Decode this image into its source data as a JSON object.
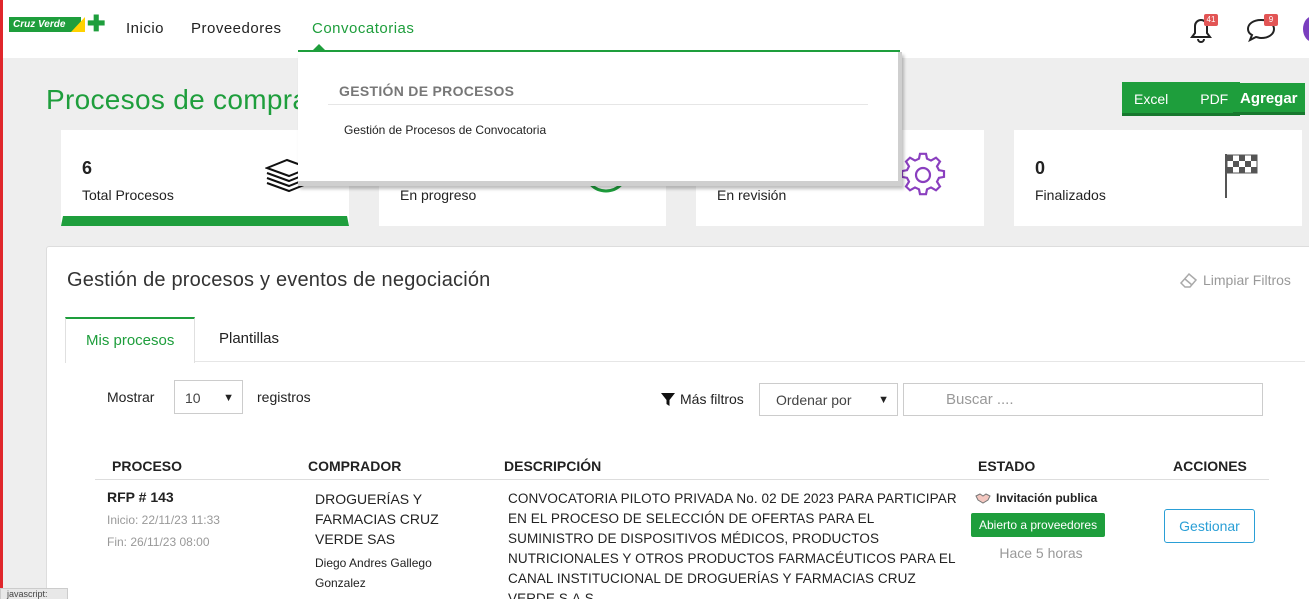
{
  "brand": {
    "logo_text": "Cruz Verde"
  },
  "nav": {
    "items": [
      {
        "label": "Inicio"
      },
      {
        "label": "Proveedores"
      },
      {
        "label": "Convocatorias"
      }
    ],
    "notifications_count": "41",
    "messages_count": "9"
  },
  "dropdown": {
    "heading": "GESTIÓN DE PROCESOS",
    "item": "Gestión de Procesos de Convocatoria"
  },
  "page": {
    "title": "Procesos de compra",
    "excel_label": "Excel",
    "pdf_label": "PDF",
    "add_label": "Agregar"
  },
  "cards": [
    {
      "value": "6",
      "label": "Total Procesos",
      "icon": "stack-icon"
    },
    {
      "value": "",
      "label": "En progreso",
      "icon": "progress-circle-icon"
    },
    {
      "value": "",
      "label": "En revisión",
      "icon": "gear-icon"
    },
    {
      "value": "0",
      "label": "Finalizados",
      "icon": "checkered-flag-icon"
    }
  ],
  "panel": {
    "title": "Gestión de procesos y eventos de negociación",
    "clear_filters": "Limpiar Filtros",
    "tabs": [
      {
        "label": "Mis procesos"
      },
      {
        "label": "Plantillas"
      }
    ],
    "show_label": "Mostrar",
    "page_size": "10",
    "records_label": "registros",
    "more_filters": "Más filtros",
    "sort_placeholder": "Ordenar por",
    "search_placeholder": "Buscar ...."
  },
  "table": {
    "headers": [
      "PROCESO",
      "COMPRADOR",
      "DESCRIPCIÓN",
      "ESTADO",
      "ACCIONES"
    ],
    "rows": [
      {
        "id": "RFP # 143",
        "start": "Inicio: 22/11/23 11:33",
        "end": "Fin: 26/11/23 08:00",
        "buyer": "DROGUERÍAS Y FARMACIAS CRUZ VERDE SAS",
        "contact": "Diego Andres Gallego Gonzalez",
        "description": "CONVOCATORIA PILOTO PRIVADA No. 02 DE 2023 PARA PARTICIPAR EN EL PROCESO DE SELECCIÓN DE OFERTAS PARA EL SUMINISTRO DE DISPOSITIVOS MÉDICOS, PRODUCTOS NUTRICIONALES Y OTROS PRODUCTOS FARMACÉUTICOS PARA EL CANAL INSTITUCIONAL DE DROGUERÍAS Y FARMACIAS CRUZ VERDE S.A.S.",
        "invitation": "Invitación publica",
        "status": "Abierto a proveedores",
        "time_ago": "Hace 5 horas",
        "action": "Gestionar"
      }
    ]
  },
  "statusbar": {
    "text": "javascript:"
  },
  "colors": {
    "brand_green": "#1e9e3c",
    "link_blue": "#2a9fd6",
    "badge_red": "#e25555",
    "gear_purple": "#8a3fbf"
  }
}
